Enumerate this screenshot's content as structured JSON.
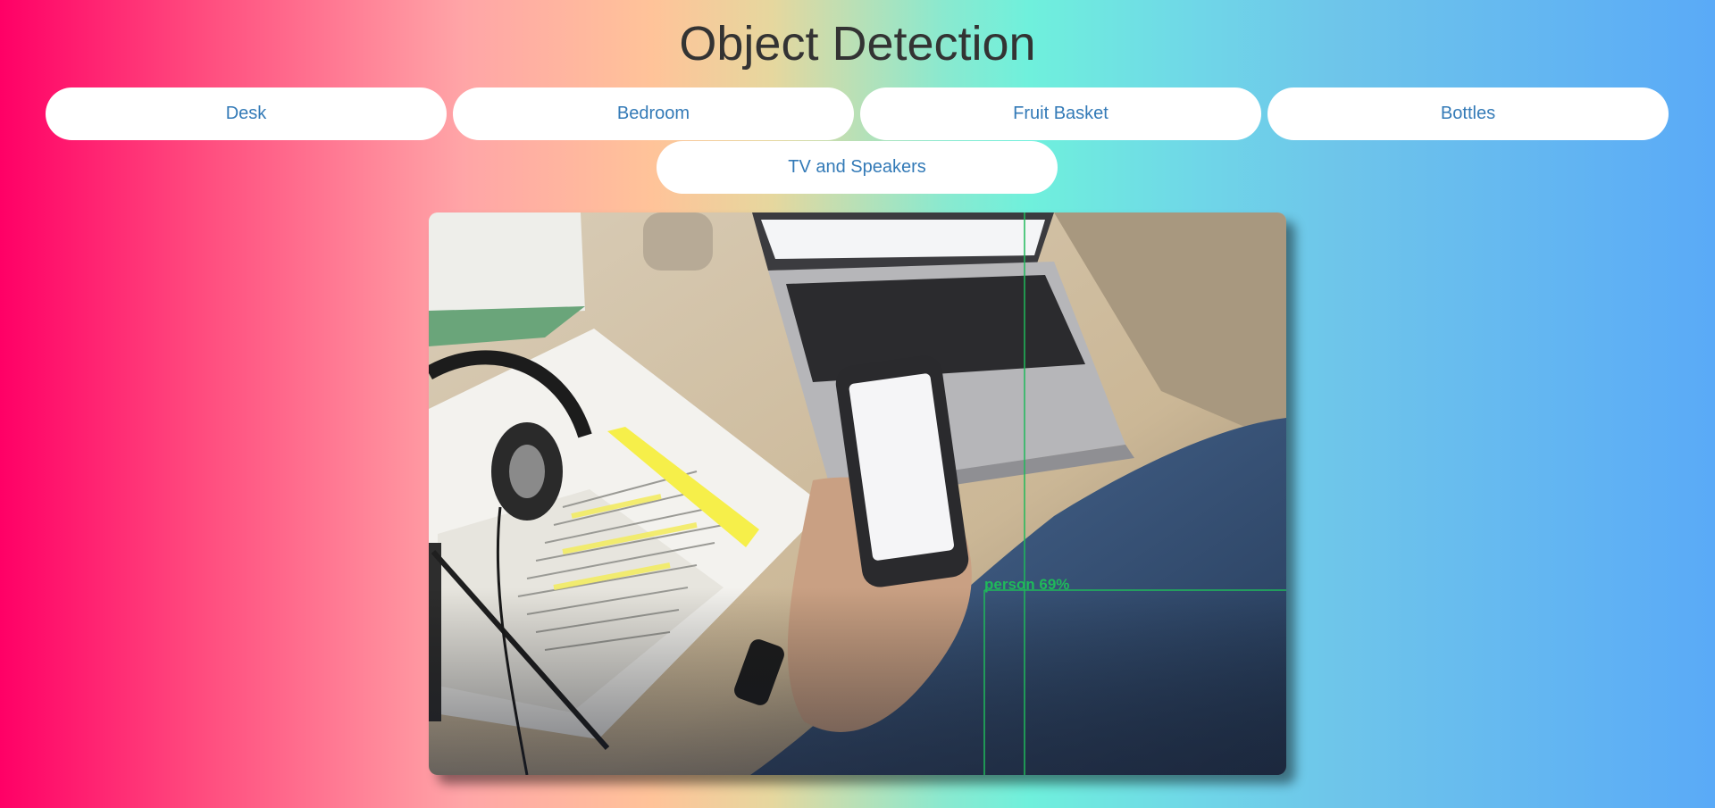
{
  "page": {
    "title": "Object Detection"
  },
  "buttons": {
    "desk": "Desk",
    "bedroom": "Bedroom",
    "fruit_basket": "Fruit Basket",
    "bottles": "Bottles",
    "tv_and_speakers": "TV and Speakers"
  },
  "detection": {
    "label": "person 69%",
    "box_color": "#1fb95a"
  },
  "colors": {
    "button_text": "#337ab7",
    "title_text": "#333333"
  }
}
